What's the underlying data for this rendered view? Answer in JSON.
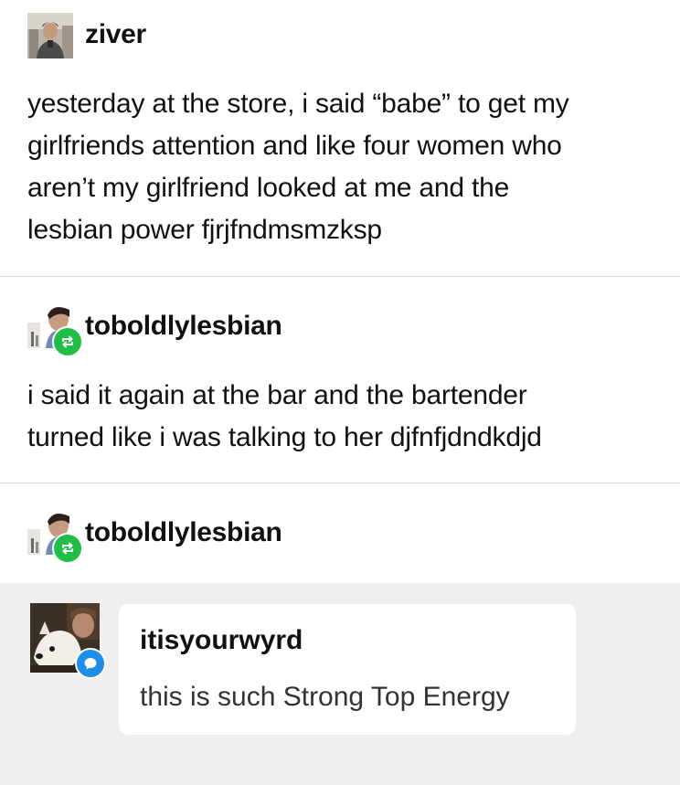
{
  "posts": [
    {
      "username": "ziver",
      "lines": [
        "yesterday at the store, i said “babe” to get my",
        "girlfriends attention and like four women who",
        "aren’t my girlfriend looked at me and the",
        "lesbian power fjrjfndmsmzksp"
      ]
    },
    {
      "username": "toboldlylesbian",
      "lines": [
        "i said it again at the bar and the bartender",
        "turned like i was talking to her djfnfjdndkdjd"
      ]
    },
    {
      "username": "toboldlylesbian"
    }
  ],
  "reply": {
    "username": "itisyourwyrd",
    "text": "this is such Strong Top Energy"
  },
  "colors": {
    "reblog_badge": "#1fbf45",
    "reply_badge": "#1d8fe8",
    "reply_background": "#efefef",
    "divider": "#d6d6d6"
  },
  "icons": {
    "reblog": "reblog-icon",
    "reply": "speech-bubble-icon"
  }
}
